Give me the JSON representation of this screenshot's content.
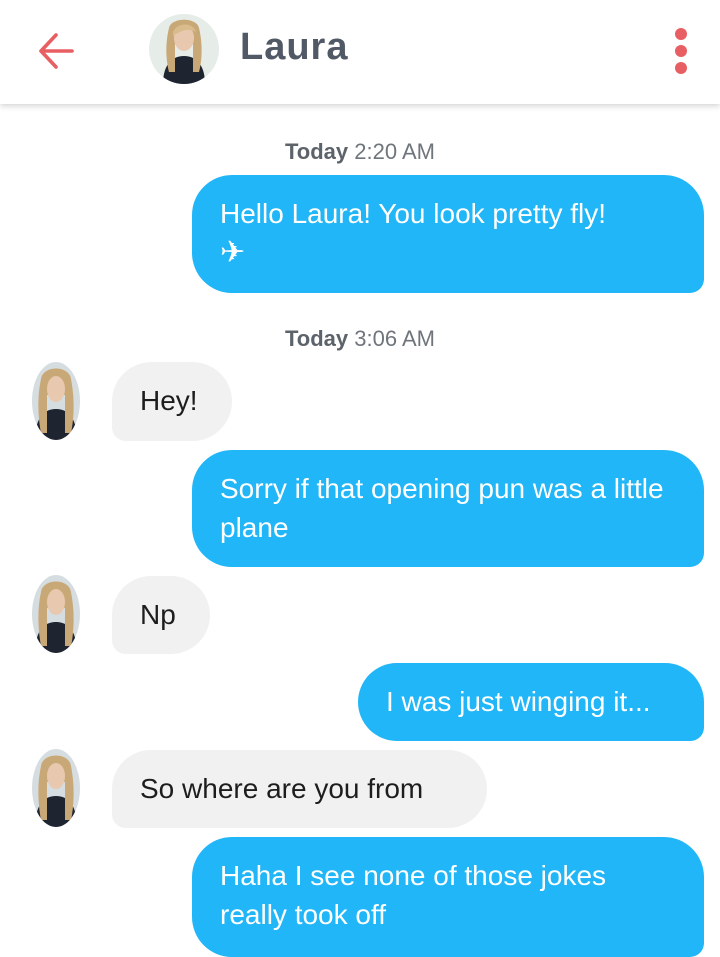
{
  "header": {
    "contact_name": "Laura",
    "back_icon": "arrow-left-icon",
    "menu_icon": "more-vertical-icon",
    "accent_color": "#e85f63"
  },
  "colors": {
    "sent_bubble": "#20b6f7",
    "received_bubble": "#f1f1f1"
  },
  "conversation": {
    "timestamps": [
      {
        "day": "Today",
        "time": "2:20 AM"
      },
      {
        "day": "Today",
        "time": "3:06 AM"
      }
    ],
    "messages": [
      {
        "direction": "sent",
        "text": "Hello Laura!  You look pretty fly!",
        "emoji": "✈"
      },
      {
        "direction": "received",
        "text": "Hey!"
      },
      {
        "direction": "sent",
        "text": "Sorry if that opening pun was a little plane"
      },
      {
        "direction": "received",
        "text": "Np"
      },
      {
        "direction": "sent",
        "text": "I was just winging it..."
      },
      {
        "direction": "received",
        "text": "So where are you from"
      },
      {
        "direction": "sent",
        "text": "Haha I see none of those jokes really took off"
      }
    ]
  }
}
